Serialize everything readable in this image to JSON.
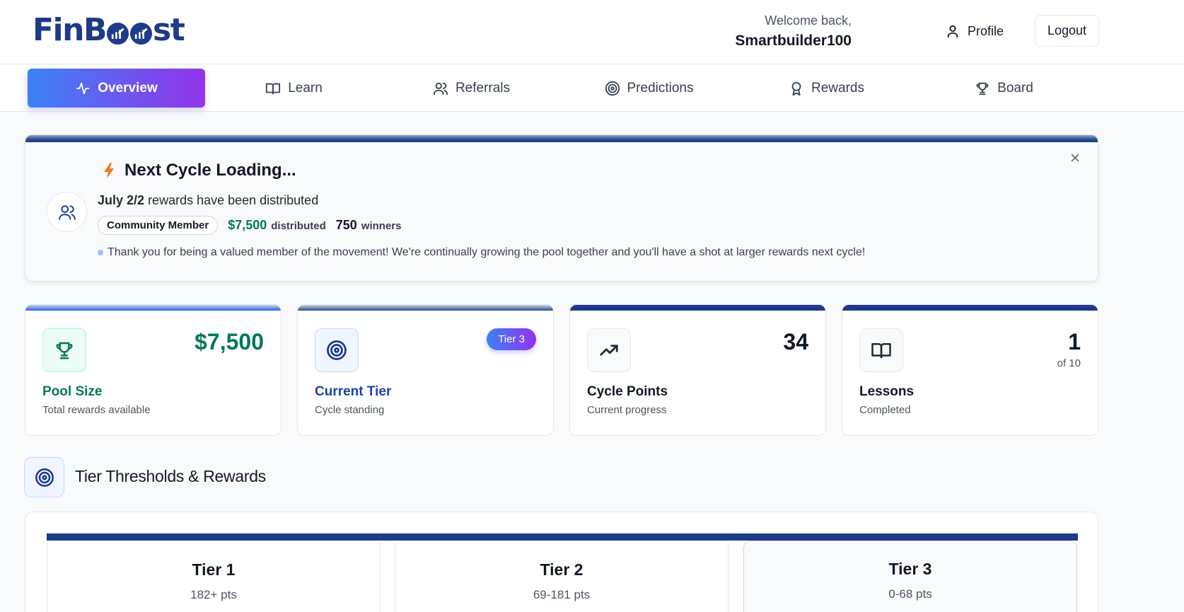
{
  "header": {
    "logo_text": "FinBoost",
    "welcome_line": "Welcome back,",
    "username": "Smartbuilder100",
    "profile_label": "Profile",
    "logout_label": "Logout"
  },
  "nav": {
    "tabs": [
      {
        "label": "Overview",
        "icon": "activity-icon",
        "active": true
      },
      {
        "label": "Learn",
        "icon": "book-icon",
        "active": false
      },
      {
        "label": "Referrals",
        "icon": "users-icon",
        "active": false
      },
      {
        "label": "Predictions",
        "icon": "target-icon",
        "active": false
      },
      {
        "label": "Rewards",
        "icon": "award-icon",
        "active": false
      },
      {
        "label": "Board",
        "icon": "trophy-icon",
        "active": false
      }
    ]
  },
  "banner": {
    "title": "Next Cycle Loading...",
    "cycle_bold": "July 2/2",
    "cycle_rest": "rewards have been distributed",
    "chip_label": "Community Member",
    "distributed_amount": "$7,500",
    "distributed_label": "distributed",
    "winners_count": "750",
    "winners_label": "winners",
    "note": "Thank you for being a valued member of the movement! We're continually growing the pool together and you'll have a shot at larger rewards next cycle!"
  },
  "stats": {
    "pool": {
      "value": "$7,500",
      "name": "Pool Size",
      "desc": "Total rewards available"
    },
    "tier": {
      "badge": "Tier 3",
      "name": "Current Tier",
      "desc": "Cycle standing"
    },
    "points": {
      "value": "34",
      "name": "Cycle Points",
      "desc": "Current progress"
    },
    "lessons": {
      "value": "1",
      "sub": "of 10",
      "name": "Lessons",
      "desc": "Completed"
    }
  },
  "tiers_section": {
    "title": "Tier Thresholds & Rewards",
    "tiers": [
      {
        "name": "Tier 1",
        "points": "182+ pts"
      },
      {
        "name": "Tier 2",
        "points": "69-181 pts"
      },
      {
        "name": "Tier 3",
        "points": "0-68 pts"
      }
    ]
  },
  "colors": {
    "brand_navy": "#1e3a8a",
    "gradient_start": "#3b82f6",
    "gradient_end": "#9333ea",
    "money_green": "#047857",
    "tier_blue": "#1e40af",
    "lightning_orange": "#f97316"
  }
}
